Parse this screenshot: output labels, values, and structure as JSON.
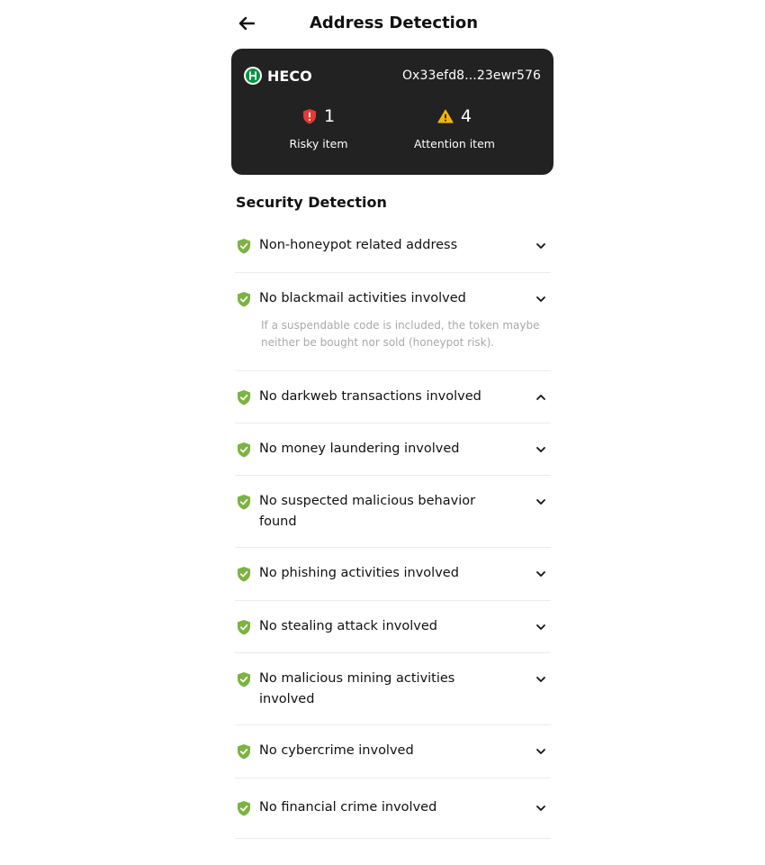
{
  "header": {
    "title": "Address Detection"
  },
  "summary": {
    "chain_name": "HECO",
    "address": "Ox33efd8...23ewr576",
    "risky_count": "1",
    "risky_label": "Risky item",
    "attention_count": "4",
    "attention_label": "Attention item"
  },
  "section": {
    "title": "Security Detection"
  },
  "items": [
    {
      "label": "Non-honeypot related address",
      "expanded": false
    },
    {
      "label": "No blackmail activities involved",
      "expanded": true,
      "description": "If a suspendable code is included, the token maybe neither be bought nor sold (honeypot risk)."
    },
    {
      "label": "No darkweb transactions involved",
      "expanded": true
    },
    {
      "label": "No money laundering involved",
      "expanded": false
    },
    {
      "label": "No suspected malicious behavior found",
      "expanded": false
    },
    {
      "label": "No phishing activities involved",
      "expanded": false
    },
    {
      "label": "No stealing attack involved",
      "expanded": false
    },
    {
      "label": "No malicious mining activities involved",
      "expanded": false
    },
    {
      "label": "No cybercrime involved",
      "expanded": false
    },
    {
      "label": "No financial crime involved",
      "expanded": false
    }
  ],
  "colors": {
    "safe": "#7cb342",
    "risk": "#e53935",
    "warning": "#f5b400",
    "card_bg": "#222222"
  },
  "icons": {
    "back": "arrow-left-icon",
    "safe": "shield-check-icon",
    "risk": "shield-alert-icon",
    "warning": "warning-triangle-icon",
    "collapsed": "chevron-down-icon",
    "expanded": "chevron-up-icon"
  }
}
